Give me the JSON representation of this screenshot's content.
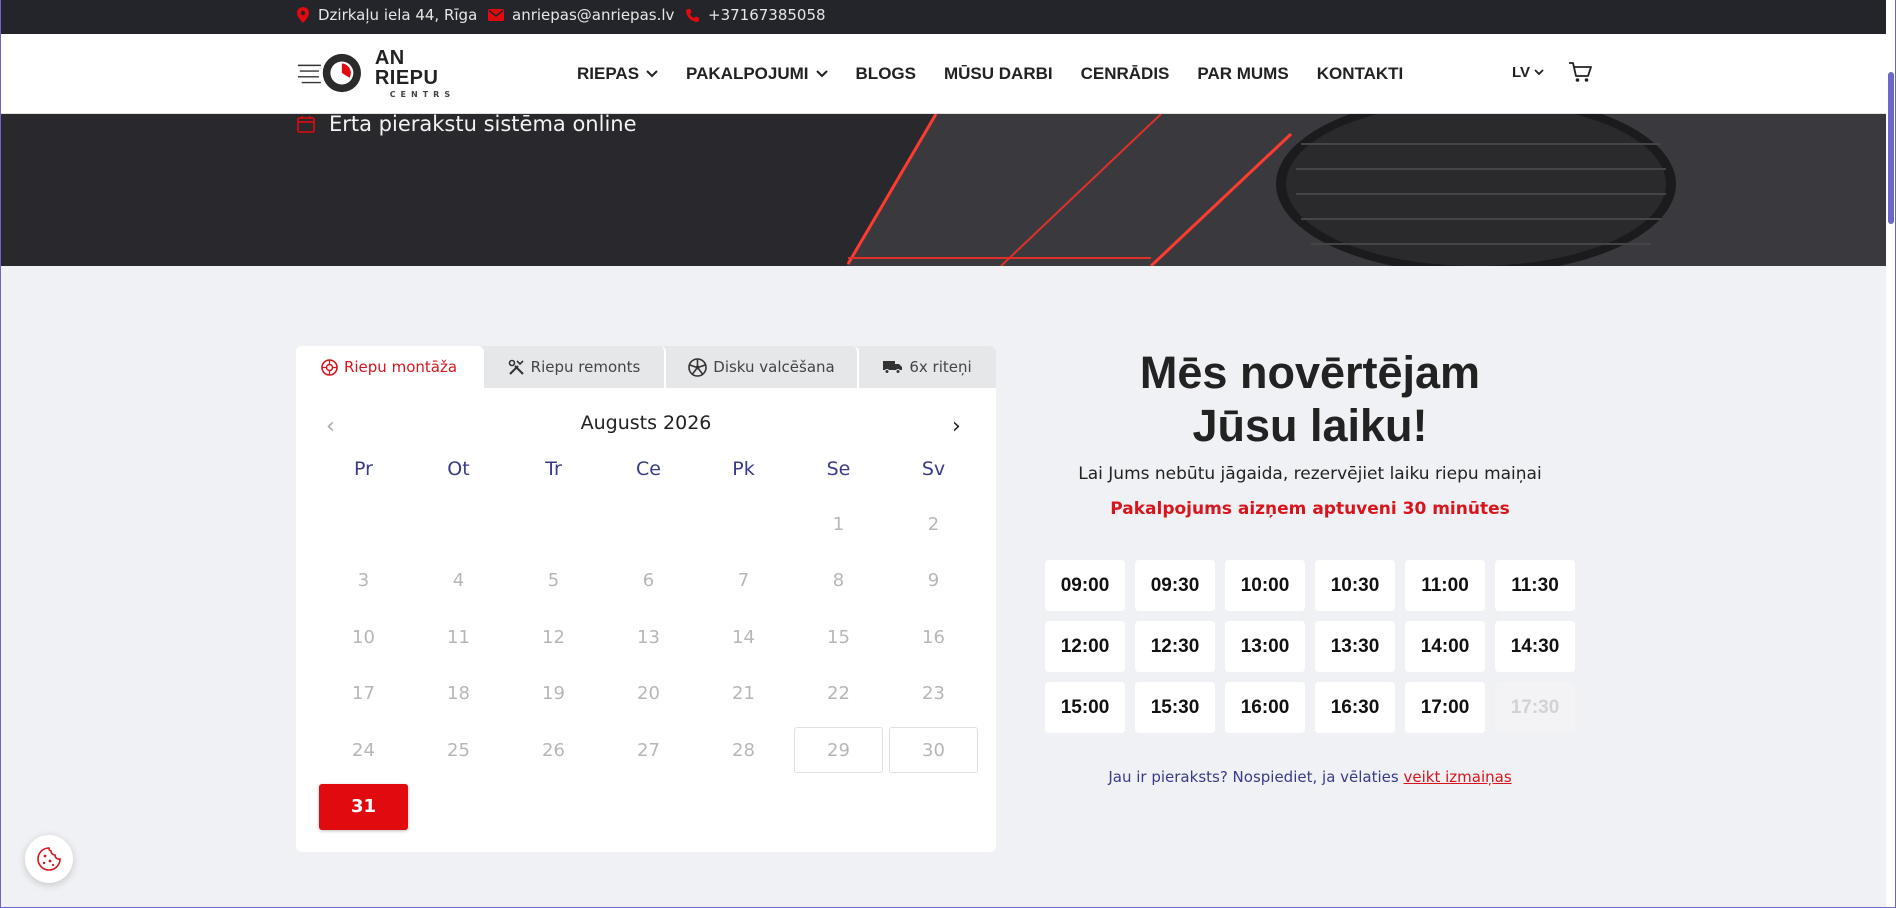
{
  "topbar": {
    "address": "Dzirkaļu iela 44, Rīga",
    "email": "anriepas@anriepas.lv",
    "phone": "+37167385058"
  },
  "logo": {
    "main": "AN RIEPU",
    "sub": "CENTRS"
  },
  "nav": {
    "items": [
      "RIEPAS",
      "PAKALPOJUMI",
      "BLOGS",
      "MŪSU DARBI",
      "CENRĀDIS",
      "PAR MUMS",
      "KONTAKTI"
    ],
    "dropdown_items": [
      "RIEPAS",
      "PAKALPOJUMI"
    ],
    "language": "LV"
  },
  "hero": {
    "feature": "Ērta pierakstu sistēma online"
  },
  "booking": {
    "tabs": [
      "Riepu montāža",
      "Riepu remonts",
      "Disku valcēšana",
      "6x riteņi"
    ],
    "active_tab": "Riepu montāža",
    "month": "Augusts 2026",
    "weekdays": [
      "Pr",
      "Ot",
      "Tr",
      "Ce",
      "Pk",
      "Se",
      "Sv"
    ],
    "first_weekday_index": 5,
    "days_in_month": 31,
    "boxed_days": [
      29,
      30
    ],
    "selected_day": 31
  },
  "info": {
    "headline_line1": "Mēs novērtējam",
    "headline_line2": "Jūsu laiku!",
    "subtitle": "Lai Jums nebūtu jāgaida, rezervējiet laiku riepu maiņai",
    "duration": "Pakalpojums aizņem aptuveni 30 minūtes",
    "change_text": "Jau ir pieraksts? Nospiediet, ja vēlaties",
    "change_link": "veikt izmaiņas"
  },
  "slots": {
    "times": [
      "09:00",
      "09:30",
      "10:00",
      "10:30",
      "11:00",
      "11:30",
      "12:00",
      "12:30",
      "13:00",
      "13:30",
      "14:00",
      "14:30",
      "15:00",
      "15:30",
      "16:00",
      "16:30",
      "17:00",
      "17:30"
    ],
    "disabled": [
      "17:30"
    ]
  },
  "colors": {
    "accent": "#d8141c",
    "dark": "#23252b",
    "weekday": "#3a3a8a"
  }
}
